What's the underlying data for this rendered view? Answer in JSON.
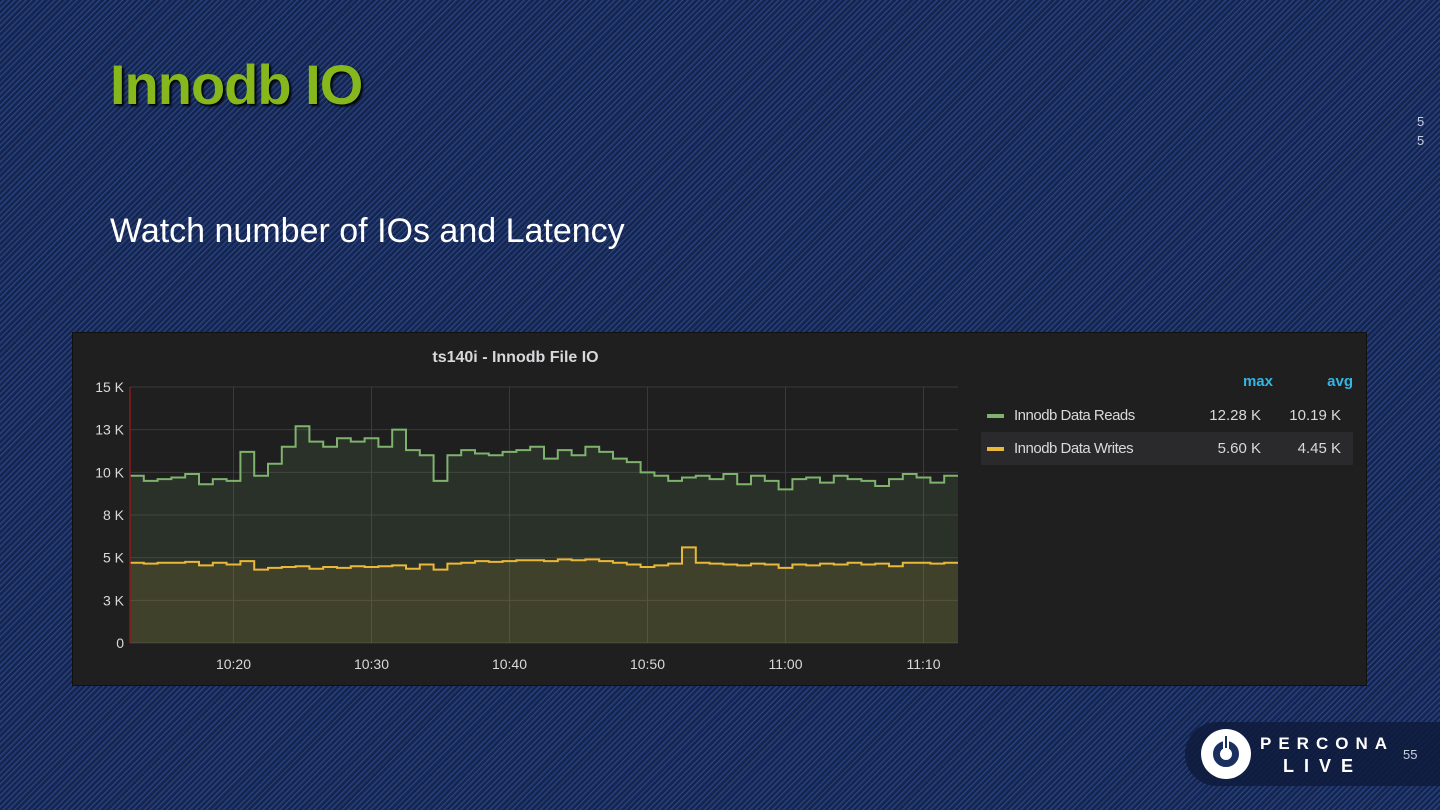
{
  "slide": {
    "title": "Innodb IO",
    "subtitle": "Watch number of IOs and Latency",
    "side_number": [
      "5",
      "5"
    ],
    "page_number": "55",
    "logo": {
      "line1": "PERCONA",
      "line2": "LIVE"
    }
  },
  "colors": {
    "reads": "#7eb26d",
    "writes": "#eab839",
    "title": "#86b81d",
    "legend_header": "#33b5e5"
  },
  "legend": {
    "headers": [
      "max",
      "avg"
    ],
    "rows": [
      {
        "name": "Innodb Data Reads",
        "max": "12.28 K",
        "avg": "10.19 K"
      },
      {
        "name": "Innodb Data Writes",
        "max": "5.60 K",
        "avg": "4.45 K"
      }
    ]
  },
  "chart_data": {
    "type": "line",
    "title": "ts140i - Innodb File IO",
    "xlabel": "",
    "ylabel": "",
    "ylim": [
      0,
      15000
    ],
    "yticks": [
      0,
      2500,
      5000,
      7500,
      10000,
      12500,
      15000
    ],
    "ytick_labels": [
      "0",
      "3 K",
      "5 K",
      "8 K",
      "10 K",
      "13 K",
      "15 K"
    ],
    "x_range_minutes": [
      "10:12.5",
      "11:12.5"
    ],
    "xtick_labels": [
      "10:20",
      "10:30",
      "10:40",
      "10:50",
      "11:00",
      "11:10"
    ],
    "x": [
      "10:13",
      "10:14",
      "10:15",
      "10:16",
      "10:17",
      "10:18",
      "10:19",
      "10:20",
      "10:21",
      "10:22",
      "10:23",
      "10:24",
      "10:25",
      "10:26",
      "10:27",
      "10:28",
      "10:29",
      "10:30",
      "10:31",
      "10:32",
      "10:33",
      "10:34",
      "10:35",
      "10:36",
      "10:37",
      "10:38",
      "10:39",
      "10:40",
      "10:41",
      "10:42",
      "10:43",
      "10:44",
      "10:45",
      "10:46",
      "10:47",
      "10:48",
      "10:49",
      "10:50",
      "10:51",
      "10:52",
      "10:53",
      "10:54",
      "10:55",
      "10:56",
      "10:57",
      "10:58",
      "10:59",
      "11:00",
      "11:01",
      "11:02",
      "11:03",
      "11:04",
      "11:05",
      "11:06",
      "11:07",
      "11:08",
      "11:09",
      "11:10",
      "11:11",
      "11:12"
    ],
    "series": [
      {
        "name": "Innodb Data Reads",
        "values": [
          9800,
          9500,
          9600,
          9700,
          9900,
          9300,
          9600,
          9500,
          11200,
          9800,
          10500,
          11500,
          12700,
          11800,
          11500,
          12000,
          11800,
          12000,
          11500,
          12500,
          11300,
          11000,
          9500,
          11000,
          11300,
          11100,
          11000,
          11200,
          11300,
          11500,
          10800,
          11300,
          11000,
          11500,
          11200,
          10800,
          10600,
          10000,
          9800,
          9500,
          9700,
          9800,
          9600,
          9900,
          9300,
          9800,
          9500,
          9000,
          9600,
          9700,
          9400,
          9800,
          9600,
          9500,
          9200,
          9600,
          9900,
          9700,
          9400,
          9800
        ]
      },
      {
        "name": "Innodb Data Writes",
        "values": [
          4700,
          4650,
          4700,
          4700,
          4750,
          4550,
          4700,
          4600,
          4800,
          4300,
          4400,
          4450,
          4500,
          4350,
          4450,
          4400,
          4500,
          4450,
          4500,
          4550,
          4350,
          4600,
          4300,
          4650,
          4700,
          4800,
          4750,
          4800,
          4850,
          4850,
          4800,
          4900,
          4850,
          4900,
          4800,
          4700,
          4600,
          4450,
          4550,
          4650,
          5600,
          4700,
          4650,
          4600,
          4550,
          4650,
          4600,
          4400,
          4600,
          4550,
          4650,
          4600,
          4700,
          4600,
          4650,
          4500,
          4700,
          4700,
          4650,
          4700
        ]
      }
    ]
  }
}
